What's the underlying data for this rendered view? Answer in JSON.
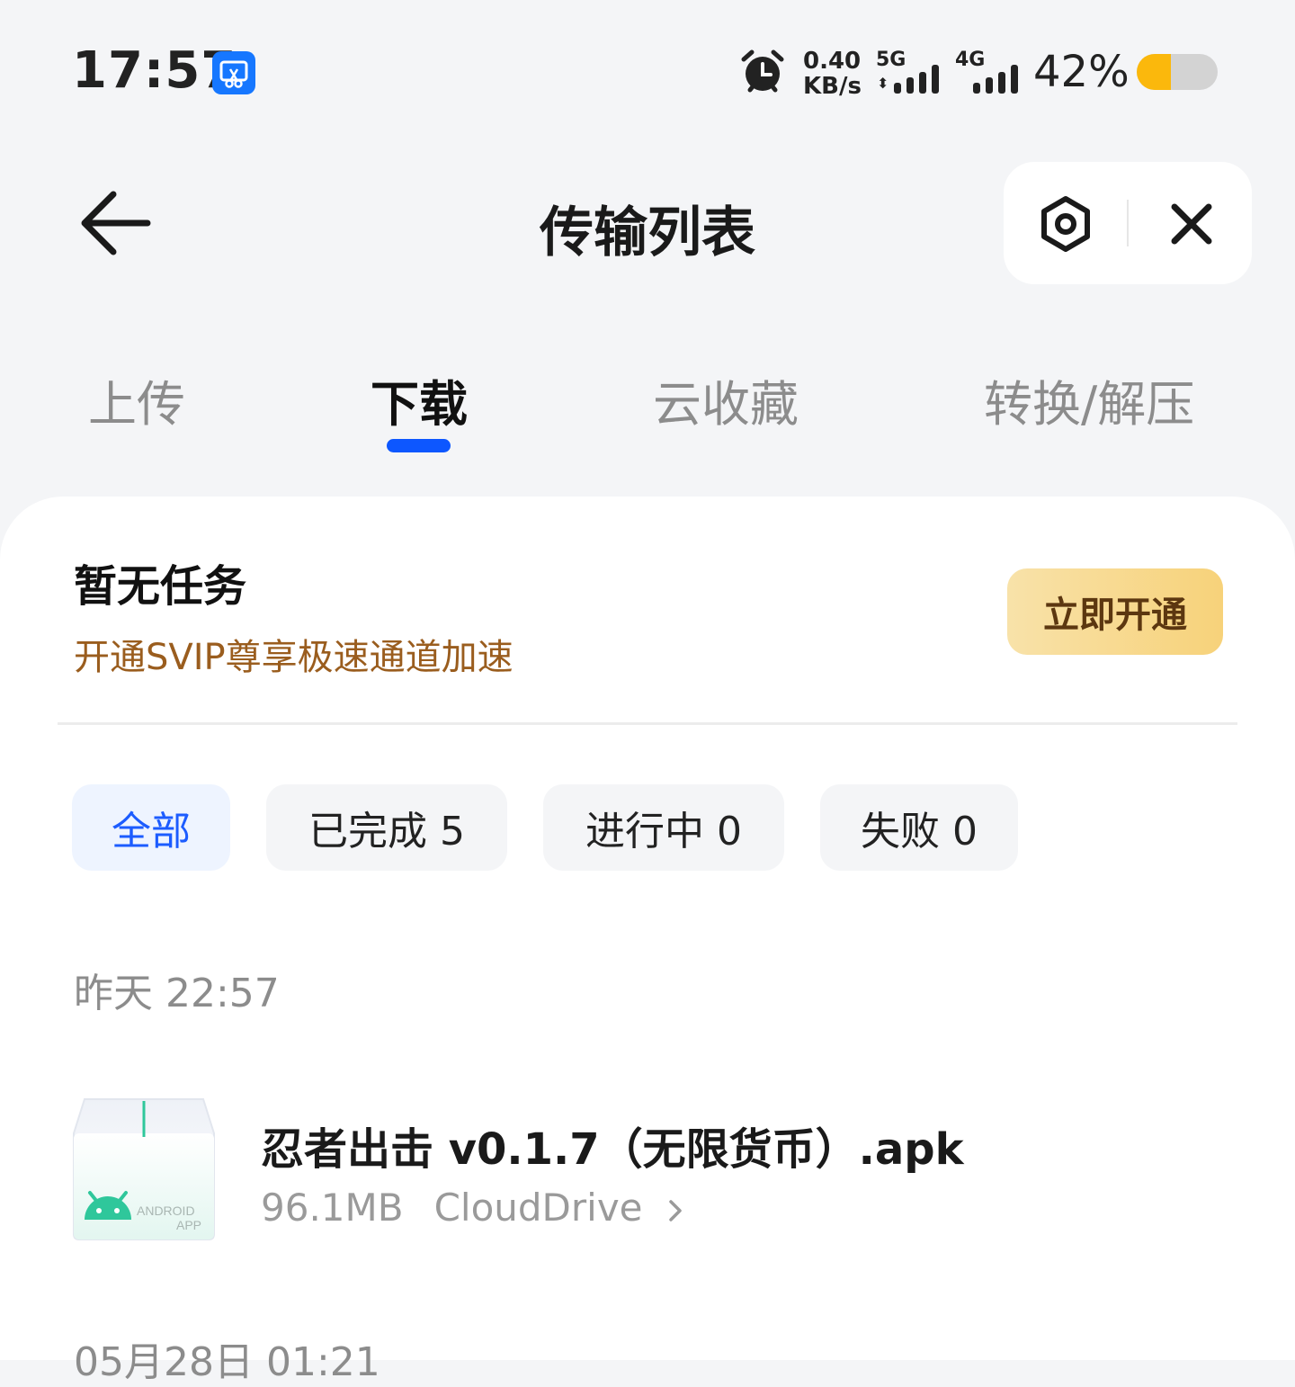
{
  "status_bar": {
    "time": "17:57",
    "net_speed_value": "0.40",
    "net_speed_unit": "KB/s",
    "signal_1_label": "5G",
    "signal_2_label": "4G",
    "battery_percent": "42%",
    "battery_level": 0.42,
    "battery_color": "#fbb80c",
    "icons": [
      "screen-cast-icon",
      "alarm-icon",
      "signal-icon",
      "battery-icon"
    ]
  },
  "header": {
    "title": "传输列表",
    "icons": [
      "back-arrow-icon",
      "settings-icon",
      "close-icon"
    ]
  },
  "tabs": [
    {
      "label": "上传",
      "active": false
    },
    {
      "label": "下载",
      "active": true
    },
    {
      "label": "云收藏",
      "active": false
    },
    {
      "label": "转换/解压",
      "active": false
    }
  ],
  "promo": {
    "title": "暂无任务",
    "subtitle": "开通SVIP尊享极速通道加速",
    "button_label": "立即开通"
  },
  "filters": [
    {
      "label": "全部",
      "active": true
    },
    {
      "label": "已完成 5",
      "active": false
    },
    {
      "label": "进行中 0",
      "active": false
    },
    {
      "label": "失败 0",
      "active": false
    }
  ],
  "groups": [
    {
      "date": "昨天 22:57",
      "items": [
        {
          "name": "忍者出击 v0.1.7（无限货币）.apk",
          "size": "96.1MB",
          "location": "CloudDrive",
          "icon_label_1": "ANDROID",
          "icon_label_2": "APP"
        }
      ]
    },
    {
      "date": "05月28日 01:21"
    }
  ],
  "colors": {
    "accent": "#0d57ff",
    "promo_text": "#9a5d1e",
    "android_green": "#2fc79b"
  }
}
